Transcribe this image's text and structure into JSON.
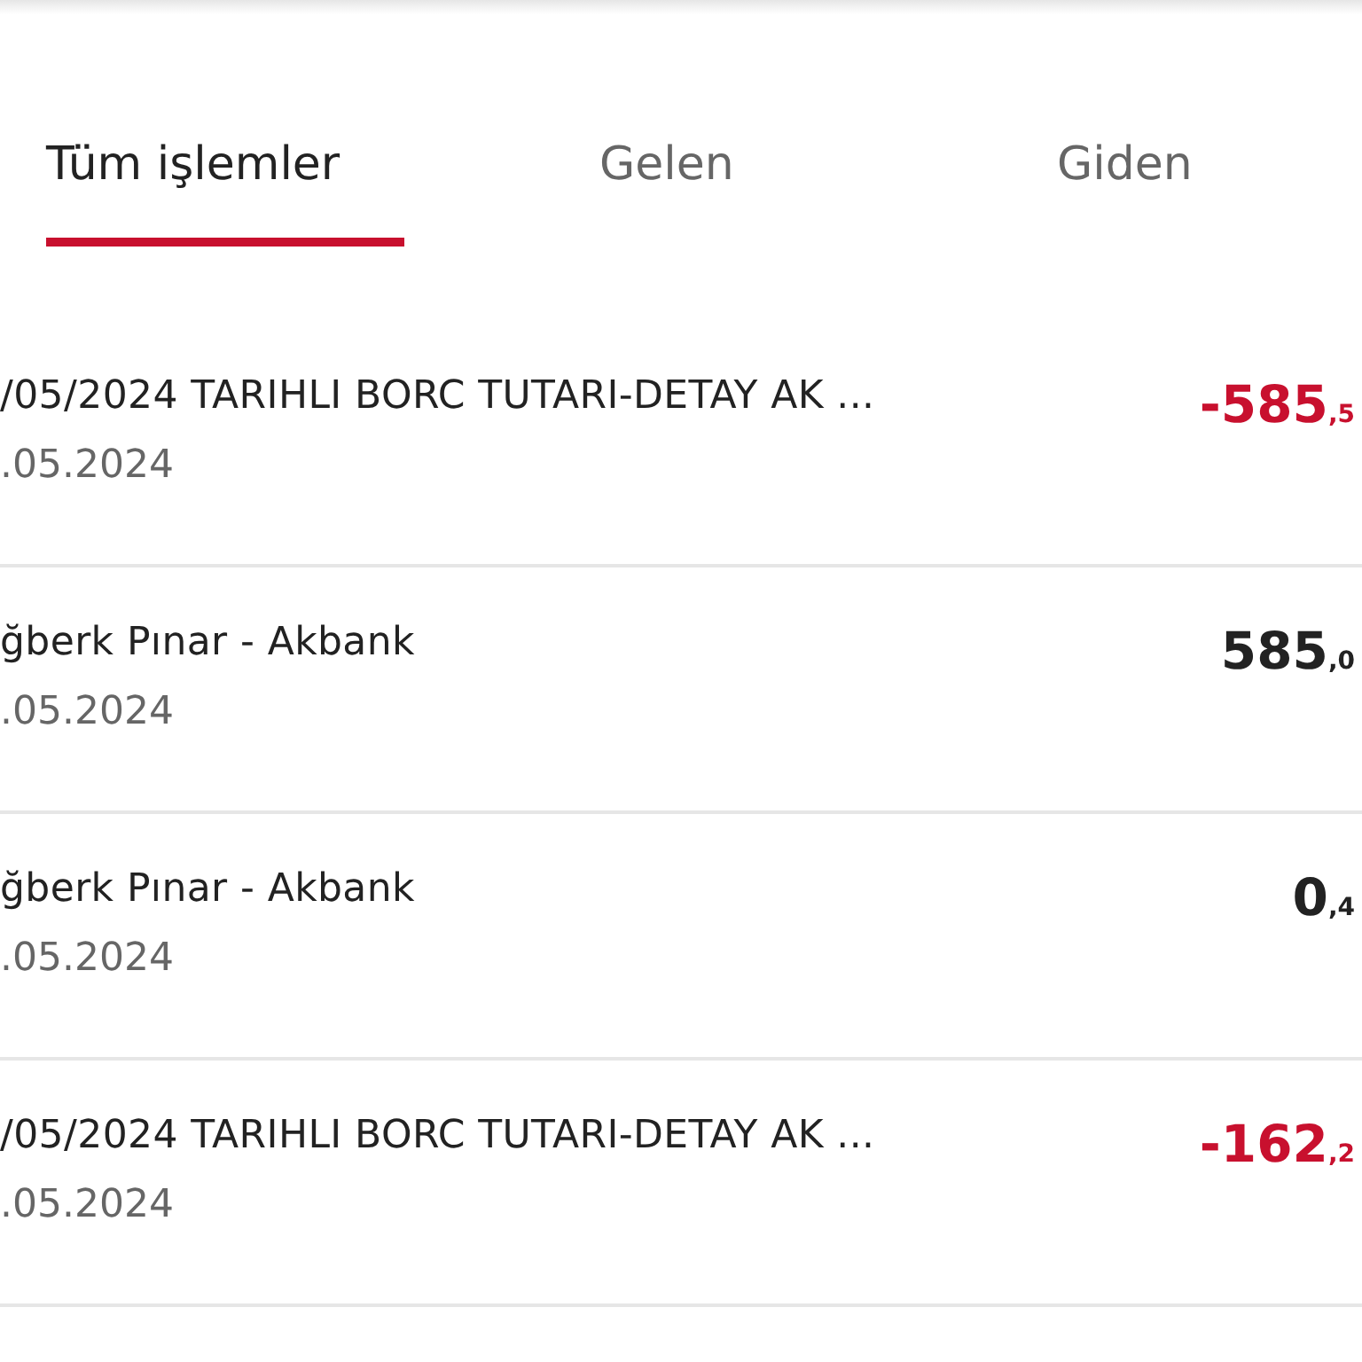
{
  "tabs": [
    {
      "label": "Tüm işlemler",
      "selected": true
    },
    {
      "label": "Gelen",
      "selected": false
    },
    {
      "label": "Giden",
      "selected": false
    }
  ],
  "transactions": [
    {
      "title": "/05/2024 TARIHLI BORC TUTARI-DETAY AK ...",
      "date": ".05.2024",
      "amount": "-585",
      "cents": ",5",
      "kind": "outgoing"
    },
    {
      "title": "ğberk Pınar - Akbank",
      "date": ".05.2024",
      "amount": "585",
      "cents": ",0",
      "kind": "incoming"
    },
    {
      "title": "ğberk Pınar - Akbank",
      "date": ".05.2024",
      "amount": "0",
      "cents": ",4",
      "kind": "incoming"
    },
    {
      "title": "/05/2024 TARIHLI BORC TUTARI-DETAY AK ...",
      "date": ".05.2024",
      "amount": "-162",
      "cents": ",2",
      "kind": "outgoing"
    }
  ]
}
